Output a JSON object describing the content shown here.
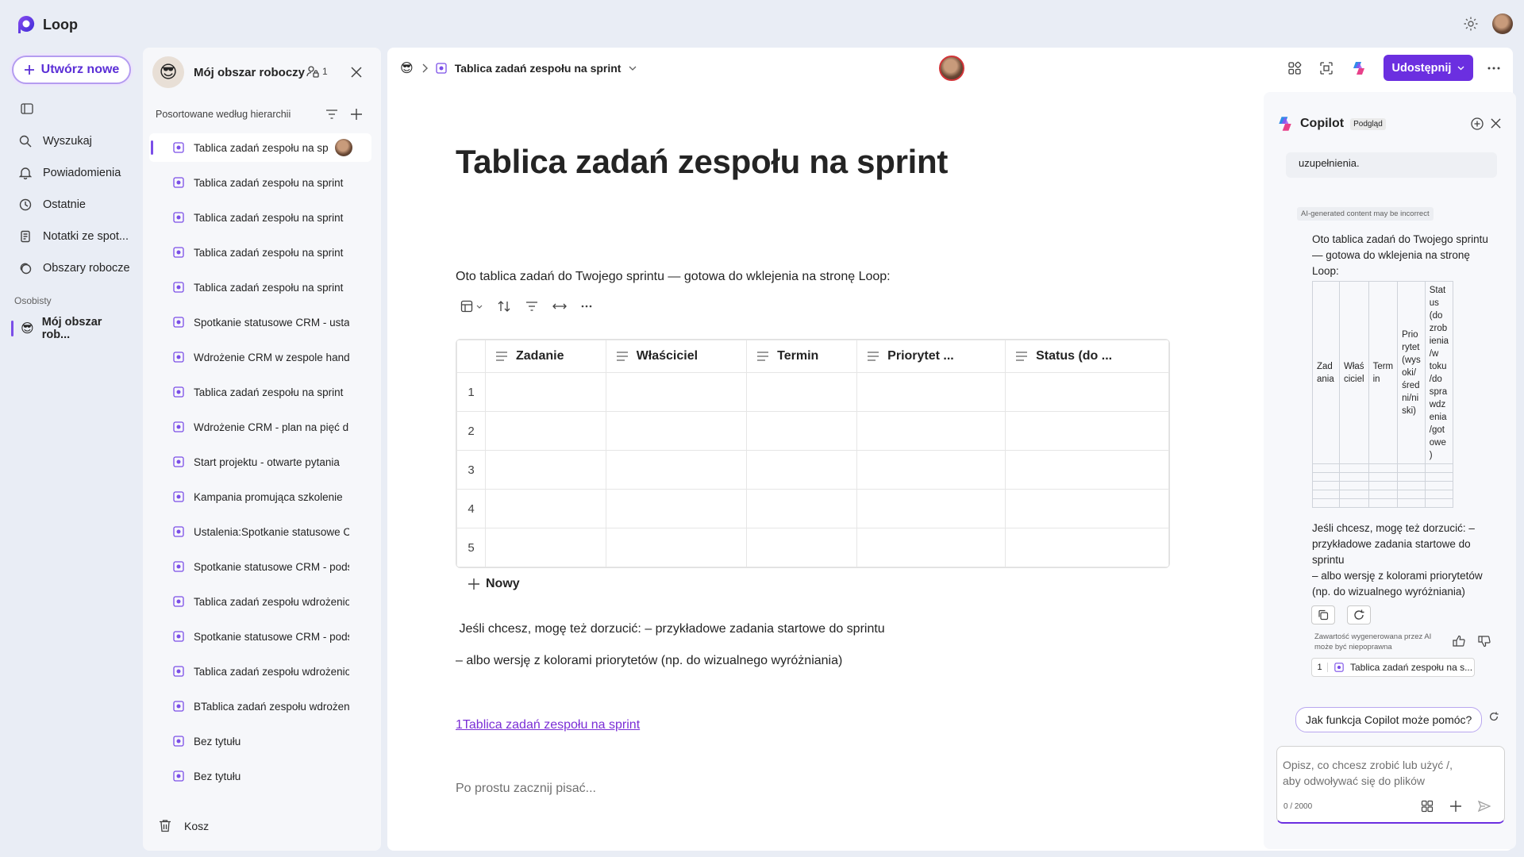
{
  "app": {
    "name": "Loop"
  },
  "nav": {
    "create_label": "Utwórz nowe",
    "items": [
      {
        "label": "Wyszukaj",
        "icon": "search-icon"
      },
      {
        "label": "Powiadomienia",
        "icon": "bell-icon"
      },
      {
        "label": "Ostatnie",
        "icon": "clock-icon"
      },
      {
        "label": "Notatki ze spot...",
        "icon": "notes-icon"
      },
      {
        "label": "Obszary robocze",
        "icon": "workspaces-icon"
      }
    ],
    "section_label": "Osobisty",
    "workspace_label": "Mój obszar rob..."
  },
  "workspace": {
    "title": "Mój obszar roboczy",
    "members_count": "1",
    "sort_label": "Posortowane według hierarchii",
    "pages": [
      "Tablica zadań zespołu na sprint",
      "Tablica zadań zespołu na sprint",
      "Tablica zadań zespołu na sprint",
      "Tablica zadań zespołu na sprint",
      "Tablica zadań zespołu na sprint",
      "Spotkanie statusowe CRM - ustalenia",
      "Wdrożenie CRM w zespole handlowym",
      "Tablica zadań zespołu na sprint",
      "Wdrożenie CRM - plan na pięć dni",
      "Start projektu - otwarte pytania",
      "Kampania promująca szkolenie",
      "Ustalenia:Spotkanie statusowe CRM",
      "Spotkanie statusowe CRM - podsumowanie",
      "Tablica zadań zespołu wdrożeniowego",
      "Spotkanie statusowe CRM - podsumowanie",
      "Tablica zadań zespołu wdrożeniowego",
      "BTablica zadań zespołu wdrożeniowego",
      "Bez tytułu",
      "Bez tytułu"
    ],
    "trash_label": "Kosz"
  },
  "doc": {
    "breadcrumb_title": "Tablica zadań zespołu na sprint",
    "share_label": "Udostępnij",
    "title": "Tablica zadań zespołu na sprint",
    "intro": "Oto tablica zadań do Twojego sprintu — gotowa do wklejenia na stronę Loop:",
    "table": {
      "columns": [
        "Zadanie",
        "Właściciel",
        "Termin",
        "Priorytet ...",
        "Status (do ..."
      ],
      "row_numbers": [
        "1",
        "2",
        "3",
        "4",
        "5"
      ]
    },
    "new_row_label": "Nowy",
    "line1": " Jeśli chcesz, mogę też dorzucić: – przykładowe zadania startowe do sprintu",
    "line2": "– albo wersję z kolorami priorytetów (np. do wizualnego wyróżniania)",
    "link": "1Tablica zadań zespołu na sprint",
    "placeholder": "Po prostu zacznij pisać..."
  },
  "copilot": {
    "title": "Copilot",
    "badge": "Podgląd",
    "prev_msg": "uzupełnienia.",
    "ai_tag": "AI-generated content may be incorrect",
    "response_intro": "Oto tablica zadań do Twojego sprintu — gotowa do wklejenia na stronę Loop:",
    "mini_table_headers": [
      "Zad ania",
      "Właś ciciel",
      "Term in",
      "Prio rytet (wys oki/ śred ni/ni ski)",
      "Stat us (do zrob ienia /w toku /do spra wdz enia /got owe )"
    ],
    "response_more": "Jeśli chcesz, mogę też dorzucić: – przykładowe zadania startowe do sprintu",
    "response_more2": "– albo wersję z kolorami priorytetów (np. do wizualnego wyróżniania)",
    "disclaimer": "Zawartość wygenerowana przez AI może być niepoprawna",
    "ref_num": "1",
    "ref_label": "Tablica zadań zespołu na s...",
    "suggestion": "Jak funkcja Copilot może pomóc?",
    "input_placeholder": "Opisz, co chcesz zrobić lub użyć /, aby odwoływać się do plików",
    "counter": "0 / 2000"
  },
  "colors": {
    "accent": "#6b2fe0",
    "link": "#7b2fd6",
    "background": "#e9edf5"
  }
}
